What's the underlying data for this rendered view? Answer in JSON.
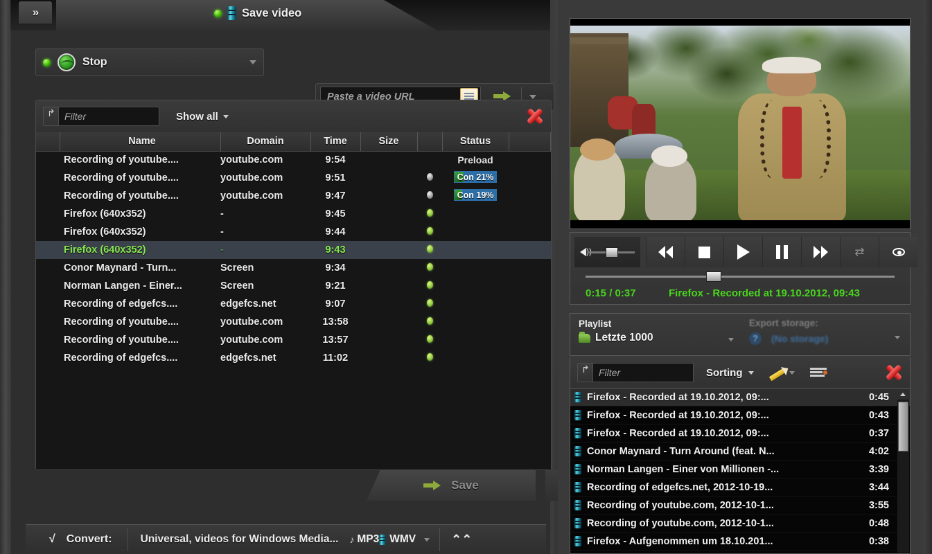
{
  "window": {
    "collapse_button": "»",
    "tab_title": "Save video"
  },
  "toolbar": {
    "stop_label": "Stop",
    "url_placeholder": "Paste a video URL",
    "url_value": ""
  },
  "downloads": {
    "filter_placeholder": "Filter",
    "show_all_label": "Show all",
    "columns": [
      "",
      "Name",
      "Domain",
      "Time",
      "Size",
      "",
      "Status"
    ],
    "rows": [
      {
        "icon": "film-icon",
        "name": "Recording of  youtube....",
        "domain": "youtube.com",
        "time": "9:54",
        "size": "",
        "dot": "",
        "status_text": "Preload",
        "status_type": "plain",
        "progress": 0,
        "selected": false
      },
      {
        "icon": "film-icon",
        "name": "Recording of  youtube....",
        "domain": "youtube.com",
        "time": "9:51",
        "size": "",
        "dot": "grey",
        "status_text": "Con 21%",
        "status_type": "bar",
        "progress": 21,
        "selected": false
      },
      {
        "icon": "film-icon",
        "name": "Recording of  youtube....",
        "domain": "youtube.com",
        "time": "9:47",
        "size": "",
        "dot": "grey",
        "status_text": "Con 19%",
        "status_type": "bar",
        "progress": 19,
        "selected": false
      },
      {
        "icon": "film-icon",
        "name": "Firefox (640x352)",
        "domain": "-",
        "time": "9:45",
        "size": "",
        "dot": "green",
        "status_text": "",
        "status_type": "none",
        "progress": 0,
        "selected": false
      },
      {
        "icon": "film-icon",
        "name": "Firefox (640x352)",
        "domain": "-",
        "time": "9:44",
        "size": "",
        "dot": "green",
        "status_text": "",
        "status_type": "none",
        "progress": 0,
        "selected": false
      },
      {
        "icon": "film-icon",
        "name": "Firefox (640x352)",
        "domain": "-",
        "time": "9:43",
        "size": "",
        "dot": "green",
        "status_text": "",
        "status_type": "none",
        "progress": 0,
        "selected": true
      },
      {
        "icon": "film-icon",
        "name": "Conor Maynard - Turn...",
        "domain": "Screen",
        "time": "9:34",
        "size": "",
        "dot": "green",
        "status_text": "",
        "status_type": "none",
        "progress": 0,
        "selected": false
      },
      {
        "icon": "film-icon",
        "name": "Norman Langen - Einer...",
        "domain": "Screen",
        "time": "9:21",
        "size": "",
        "dot": "green",
        "status_text": "",
        "status_type": "none",
        "progress": 0,
        "selected": false
      },
      {
        "icon": "film-icon",
        "name": "Recording of  edgefcs....",
        "domain": "edgefcs.net",
        "time": "9:07",
        "size": "",
        "dot": "green",
        "status_text": "",
        "status_type": "none",
        "progress": 0,
        "selected": false
      },
      {
        "icon": "film-icon",
        "name": "Recording of  youtube....",
        "domain": "youtube.com",
        "time": "13:58",
        "size": "",
        "dot": "green",
        "status_text": "",
        "status_type": "none",
        "progress": 0,
        "selected": false
      },
      {
        "icon": "film-icon",
        "name": "Recording of  youtube....",
        "domain": "youtube.com",
        "time": "13:57",
        "size": "",
        "dot": "green",
        "status_text": "",
        "status_type": "none",
        "progress": 0,
        "selected": false
      },
      {
        "icon": "film-icon",
        "name": "Recording of  edgefcs....",
        "domain": "edgefcs.net",
        "time": "11:02",
        "size": "",
        "dot": "green",
        "status_text": "",
        "status_type": "none",
        "progress": 0,
        "selected": false
      }
    ]
  },
  "save_bar": {
    "save_label": "Save"
  },
  "convert_bar": {
    "checkmark": "√",
    "label": "Convert:",
    "preset": "Universal, videos for Windows Media...",
    "audio_format": "MP3",
    "video_format": "WMV",
    "expand": "⌃⌃"
  },
  "player": {
    "time_text": "0:15 / 0:37",
    "now_playing": "Firefox - Recorded at 19.10.2012, 09:43",
    "position_seconds": 15,
    "duration_seconds": 37,
    "volume_percent": 40,
    "buttons": [
      "rewind",
      "stop",
      "play",
      "pause",
      "fast-forward",
      "shuffle",
      "eye"
    ]
  },
  "playlist": {
    "label": "Playlist",
    "name": "Letzte 1000",
    "export_label": "Export storage:",
    "export_value": "(No storage)",
    "filter_placeholder": "Filter",
    "sorting_label": "Sorting",
    "items": [
      {
        "title": "Firefox - Recorded at 19.10.2012, 09:...",
        "duration": "0:45",
        "selected": true
      },
      {
        "title": "Firefox - Recorded at 19.10.2012, 09:...",
        "duration": "0:43",
        "selected": false
      },
      {
        "title": "Firefox - Recorded at 19.10.2012, 09:...",
        "duration": "0:37",
        "selected": false
      },
      {
        "title": "Conor Maynard - Turn Around (feat. N...",
        "duration": "4:02",
        "selected": false
      },
      {
        "title": "Norman Langen - Einer von Millionen -...",
        "duration": "3:39",
        "selected": false
      },
      {
        "title": "Recording of  edgefcs.net, 2012-10-19...",
        "duration": "3:44",
        "selected": false
      },
      {
        "title": "Recording of  youtube.com, 2012-10-1...",
        "duration": "3:55",
        "selected": false
      },
      {
        "title": "Recording of  youtube.com, 2012-10-1...",
        "duration": "0:48",
        "selected": false
      },
      {
        "title": "Firefox - Aufgenommen um 18.10.201...",
        "duration": "0:38",
        "selected": false
      }
    ]
  },
  "colors": {
    "accent_green": "#49d41e",
    "status_progress": "#2f8a2f",
    "status_remaining": "#2b6ea8",
    "close_red": "#b80f0f",
    "panel_bg": "#2e2e2e",
    "list_bg": "#161616"
  }
}
